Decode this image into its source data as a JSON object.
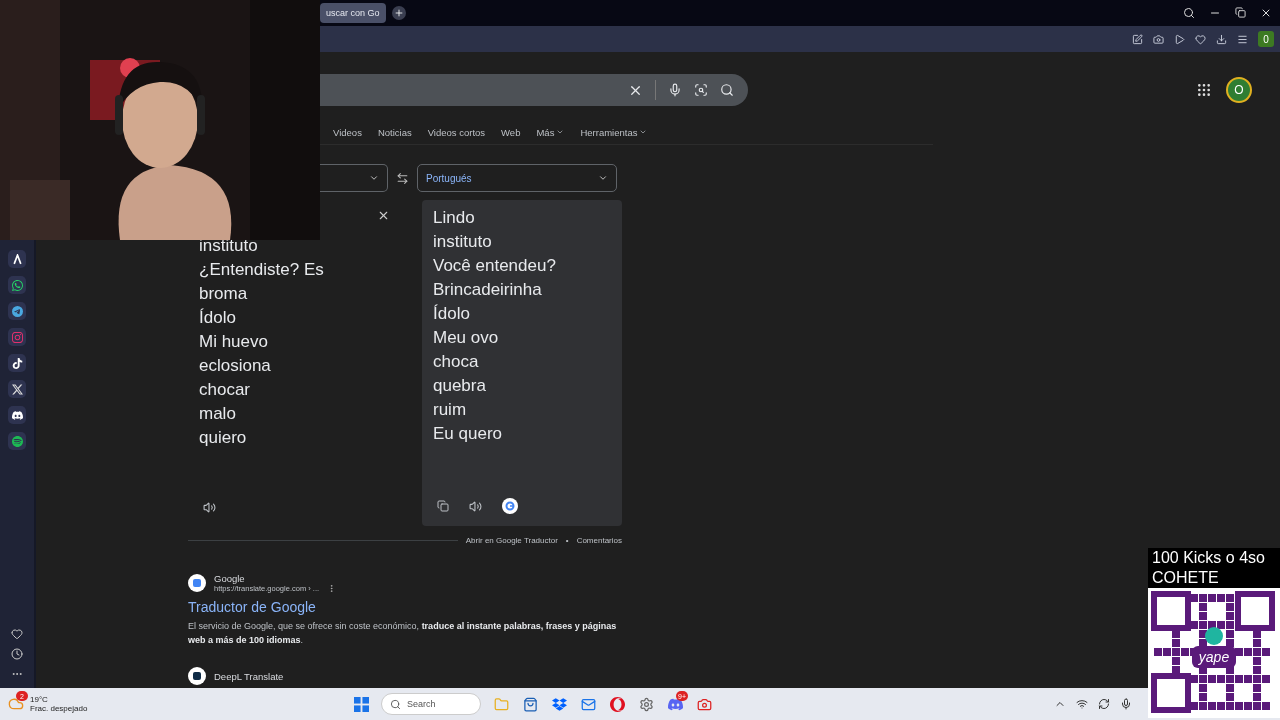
{
  "browser": {
    "tabs": [
      {
        "label": "uscar con Go",
        "selected": true
      }
    ],
    "profile_badge": "0"
  },
  "search": {
    "tabs": [
      {
        "label": "Videos",
        "selected": false,
        "menu": false
      },
      {
        "label": "Noticias",
        "selected": false,
        "menu": false
      },
      {
        "label": "Videos cortos",
        "selected": false,
        "menu": false
      },
      {
        "label": "Web",
        "selected": false,
        "menu": false
      },
      {
        "label": "Más",
        "selected": false,
        "menu": true
      },
      {
        "label": "Herramientas",
        "selected": false,
        "menu": true
      }
    ],
    "avatar": "O"
  },
  "translator": {
    "target_language": "Portugués",
    "source_lines": [
      "instituto",
      "¿Entendiste? Es",
      "broma",
      "Ídolo",
      "Mi huevo",
      "eclosiona",
      "chocar",
      "malo",
      "quiero"
    ],
    "target_lines": [
      "Lindo",
      "instituto",
      "Você entendeu?",
      "Brincadeirinha",
      "Ídolo",
      "Meu ovo",
      "choca",
      "quebra",
      "ruim",
      "Eu quero"
    ],
    "links": [
      "Abrir en Google Traductor",
      "•",
      "Comentarios"
    ]
  },
  "results": [
    {
      "site": "Google",
      "url": "https://translate.google.com › ...",
      "title": "Traductor de Google",
      "snippet": "El servicio de Google, que se ofrece sin coste económico, **traduce al instante palabras, frases y páginas web a más de 100 idiomas**."
    },
    {
      "site": "DeepL Translate"
    }
  ],
  "taskbar": {
    "weather_badge": "2",
    "temperature": "19°C",
    "condition": "Frac. despejado",
    "search_placeholder": "Search",
    "chat_badge": "9+"
  },
  "overlay": {
    "lines": [
      "100 Kicks o 4so",
      "COHETE"
    ],
    "qr_logo": "yape"
  }
}
